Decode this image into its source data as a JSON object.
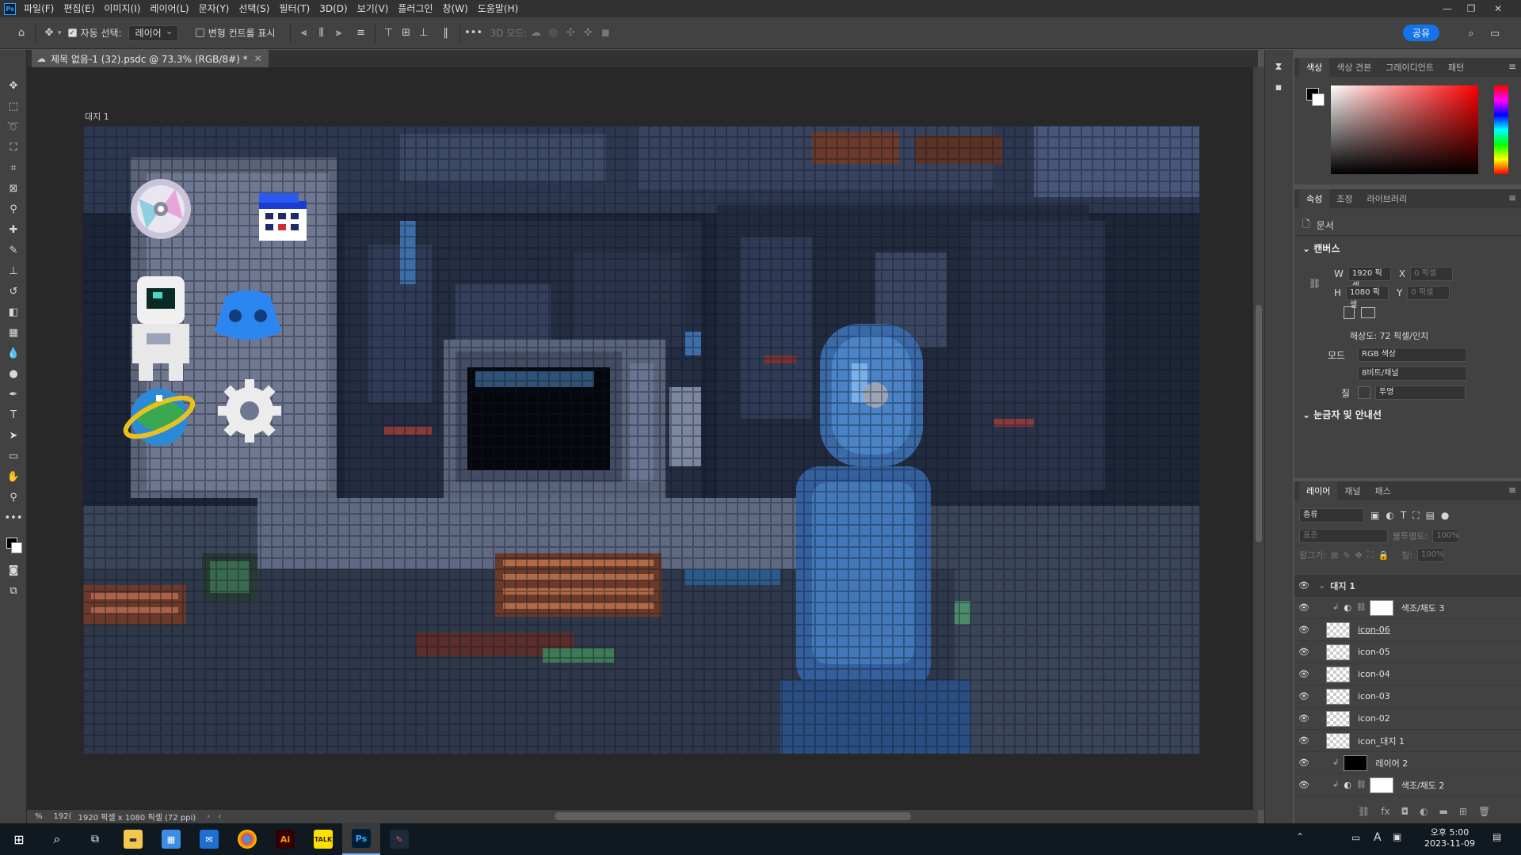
{
  "app": {
    "logo": "Ps"
  },
  "menu": [
    "파일(F)",
    "편집(E)",
    "이미지(I)",
    "레이어(L)",
    "문자(Y)",
    "선택(S)",
    "필터(T)",
    "3D(D)",
    "보기(V)",
    "플러그인",
    "창(W)",
    "도움말(H)"
  ],
  "options": {
    "auto_select_label": "자동 선택:",
    "auto_select_value": "레이어",
    "transform_label": "변형 컨트롤 표시",
    "mode3d_label": "3D 모드:",
    "share_label": "공유"
  },
  "document": {
    "tab_title": "제목 없음-1 (32).psdc @ 73.3% (RGB/8#) *",
    "artboard_label": "대지 1"
  },
  "status": {
    "zoom": "%",
    "left": "192(",
    "info": "1920 픽셀 x 1080 픽셀 (72 ppi)"
  },
  "color_panel": {
    "tabs": [
      "색상",
      "색상 견본",
      "그레이디언트",
      "패턴"
    ]
  },
  "properties": {
    "tabs": [
      "속성",
      "조정",
      "라이브러리"
    ],
    "doc_label": "문서",
    "canvas_header": "캔버스",
    "w_label": "W",
    "w_value": "1920 픽셀",
    "h_label": "H",
    "h_value": "1080 픽셀",
    "x_label": "X",
    "x_value": "0 픽셀",
    "y_label": "Y",
    "y_value": "0 픽셀",
    "resolution": "해상도: 72 픽셀/인치",
    "mode_label": "모드",
    "mode_value": "RGB 색상",
    "bits_value": "8비트/채널",
    "fill_label": "칠",
    "fill_value": "투명",
    "rulers_header": "눈금자 및 안내선"
  },
  "layers": {
    "tabs": [
      "레이어",
      "채널",
      "패스"
    ],
    "filter_label": "종류",
    "blend_mode": "표준",
    "opacity_label": "불투명도:",
    "opacity_value": "100%",
    "lock_label": "잠그기:",
    "fill_label": "칠:",
    "fill_value": "100%",
    "items": [
      {
        "name": "대지 1",
        "type": "artboard"
      },
      {
        "name": "색조/채도 3",
        "type": "adjustment"
      },
      {
        "name": "icon-06",
        "type": "pixel"
      },
      {
        "name": "icon-05",
        "type": "pixel"
      },
      {
        "name": "icon-04",
        "type": "pixel"
      },
      {
        "name": "icon-03",
        "type": "pixel"
      },
      {
        "name": "icon-02",
        "type": "pixel"
      },
      {
        "name": "icon_대지 1",
        "type": "pixel"
      },
      {
        "name": "레이어 2",
        "type": "black"
      },
      {
        "name": "색조/채도 2",
        "type": "adjustment"
      }
    ]
  },
  "taskbar": {
    "apps": [
      "Ai",
      "TALK",
      "Ps"
    ],
    "time": "오후 5:00",
    "date": "2023-11-09",
    "ime": "A"
  }
}
